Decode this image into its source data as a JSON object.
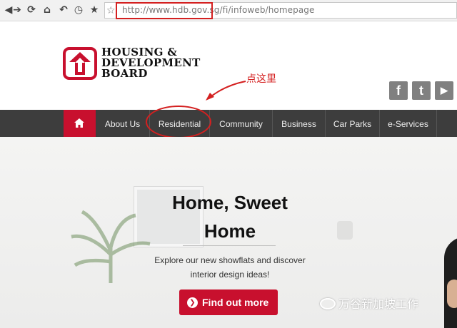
{
  "browser": {
    "url": "http://www.hdb.gov.sg/fi/infoweb/homepage",
    "icons": [
      "back-icon",
      "forward-icon",
      "reload-icon",
      "home-icon",
      "undo-icon",
      "history-icon",
      "bookmark-star-icon"
    ]
  },
  "header": {
    "logo_lines": [
      "HOUSING &",
      "DEVELOPMENT",
      "BOARD"
    ],
    "annotation": "点这里",
    "social": {
      "facebook": "f",
      "twitter": "t",
      "youtube": "▶"
    }
  },
  "nav": {
    "items": [
      "About Us",
      "Residential",
      "Community",
      "Business",
      "Car Parks",
      "e-Services"
    ]
  },
  "hero": {
    "title_line1": "Home, Sweet",
    "title_line2": "Home",
    "subtitle_line1": "Explore our new showflats and discover",
    "subtitle_line2": "interior design ideas!",
    "cta_label": "Find out more",
    "watermark": "万谷新加坡工作"
  },
  "colors": {
    "brand_red": "#c8102e",
    "nav_bg": "#3d3d3d",
    "annotation_red": "#d42020"
  }
}
